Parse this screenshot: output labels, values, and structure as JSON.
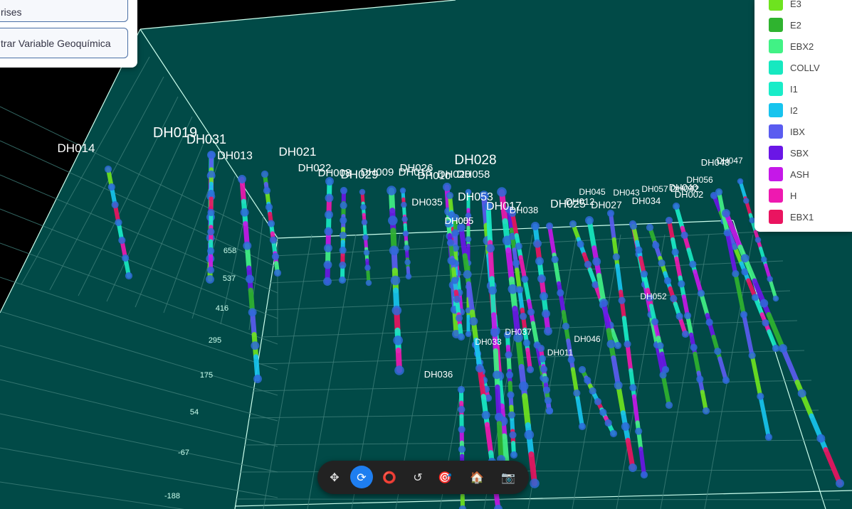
{
  "panel": {
    "button_1_label": "rises",
    "button_2_label": "trar Variable Geoquímica"
  },
  "legend": {
    "items": [
      {
        "label": "E3",
        "color": "#6ee31f"
      },
      {
        "label": "E2",
        "color": "#2fb32f"
      },
      {
        "label": "EBX2",
        "color": "#41f285"
      },
      {
        "label": "COLLV",
        "color": "#17e8c0"
      },
      {
        "label": "I1",
        "color": "#19ecc8"
      },
      {
        "label": "I2",
        "color": "#17c4ee"
      },
      {
        "label": "IBX",
        "color": "#5a5cf0"
      },
      {
        "label": "SBX",
        "color": "#6a16e6"
      },
      {
        "label": "ASH",
        "color": "#c518e8"
      },
      {
        "label": "H",
        "color": "#ee19b0"
      },
      {
        "label": "EBX1",
        "color": "#ea1460"
      }
    ]
  },
  "axis": {
    "elevation_ticks": [
      "658",
      "537",
      "416",
      "295",
      "175",
      "54",
      "-67",
      "-188"
    ]
  },
  "drillholes": [
    {
      "label": "DH014"
    },
    {
      "label": "DH019"
    },
    {
      "label": "DH031"
    },
    {
      "label": "DH013"
    },
    {
      "label": "DH021"
    },
    {
      "label": "DH022"
    },
    {
      "label": "DH008"
    },
    {
      "label": "DH029"
    },
    {
      "label": "DH009"
    },
    {
      "label": "DH026"
    },
    {
      "label": "DH018"
    },
    {
      "label": "DH010"
    },
    {
      "label": "DH020"
    },
    {
      "label": "DH058"
    },
    {
      "label": "DH028"
    },
    {
      "label": "DH035"
    },
    {
      "label": "DH053"
    },
    {
      "label": "DH017"
    },
    {
      "label": "DH038"
    },
    {
      "label": "DH005"
    },
    {
      "label": "DH025"
    },
    {
      "label": "DH012"
    },
    {
      "label": "DH045"
    },
    {
      "label": "DH027"
    },
    {
      "label": "DH043"
    },
    {
      "label": "DH034"
    },
    {
      "label": "DH057"
    },
    {
      "label": "DH042"
    },
    {
      "label": "DH056"
    },
    {
      "label": "DH002"
    },
    {
      "label": "DH048"
    },
    {
      "label": "DH047"
    },
    {
      "label": "DH040"
    },
    {
      "label": "DH052"
    },
    {
      "label": "DH037"
    },
    {
      "label": "DH033"
    },
    {
      "label": "DH011"
    },
    {
      "label": "DH046"
    },
    {
      "label": "DH036"
    },
    {
      "label": "DH055"
    }
  ],
  "toolbar": {
    "tools": [
      {
        "name": "pan-tool",
        "glyph": "✥"
      },
      {
        "name": "rotate-tool",
        "glyph": "⟳"
      },
      {
        "name": "orbit-tool",
        "glyph": "⭕"
      },
      {
        "name": "reset-rotation-tool",
        "glyph": "↺"
      },
      {
        "name": "target-tool",
        "glyph": "🎯"
      },
      {
        "name": "home-tool",
        "glyph": "🏠"
      },
      {
        "name": "screenshot-tool",
        "glyph": "📷"
      }
    ],
    "active_tool": "rotate-tool"
  }
}
